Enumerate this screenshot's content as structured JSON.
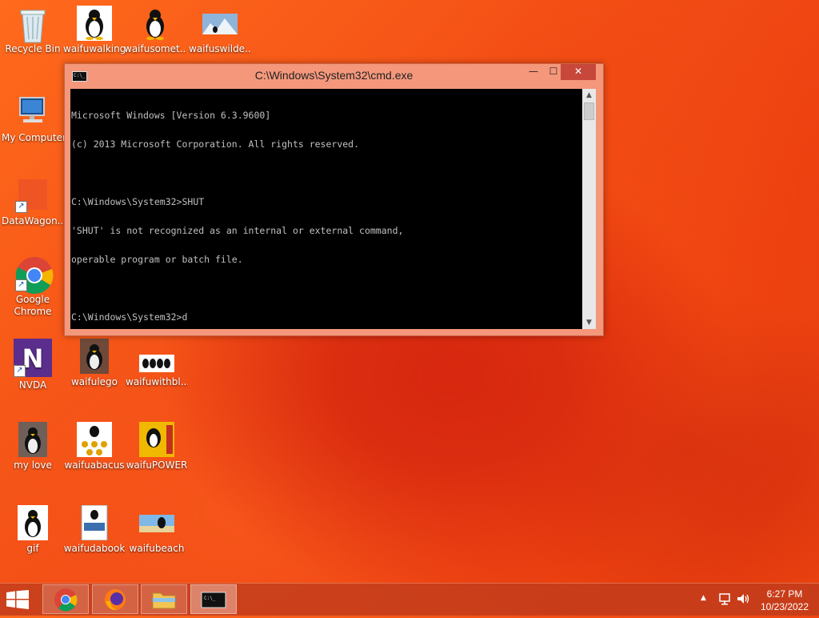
{
  "desktop": {
    "icons": [
      {
        "label": "Recycle Bin"
      },
      {
        "label": "waifuwalking"
      },
      {
        "label": "waifusomet..."
      },
      {
        "label": "waifuswilde..."
      },
      {
        "label": "My Computer"
      },
      {
        "label": "DataWagon..."
      },
      {
        "label": "Google Chrome"
      },
      {
        "label": "NVDA"
      },
      {
        "label": "waifulego"
      },
      {
        "label": "waifuwithbl..."
      },
      {
        "label": "my love"
      },
      {
        "label": "waifuabacus"
      },
      {
        "label": "waifuPOWER"
      },
      {
        "label": "gif"
      },
      {
        "label": "waifudabook"
      },
      {
        "label": "waifubeach"
      }
    ]
  },
  "cmd": {
    "title": "C:\\Windows\\System32\\cmd.exe",
    "lines": [
      "Microsoft Windows [Version 6.3.9600]",
      "(c) 2013 Microsoft Corporation. All rights reserved.",
      "",
      "C:\\Windows\\System32>SHUT",
      "'SHUT' is not recognized as an internal or external command,",
      "operable program or batch file.",
      "",
      "C:\\Windows\\System32>d"
    ],
    "min_glyph": "—",
    "max_glyph": "☐",
    "close_glyph": "✕"
  },
  "taskbar": {
    "apps": [
      "chrome-icon",
      "firefox-icon",
      "file-explorer-icon",
      "cmd-icon"
    ],
    "time": "6:27 PM",
    "date": "10/23/2022"
  },
  "colors": {
    "desktop_accent": "#f24d15",
    "cmd_frame": "#f4977b",
    "cmd_close": "#c7483a"
  }
}
